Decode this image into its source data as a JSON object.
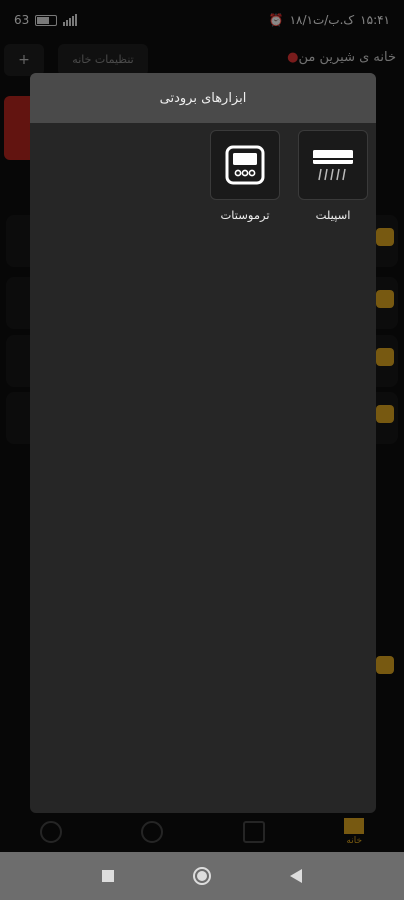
{
  "status_bar": {
    "time": "۱۵:۴۱",
    "date": "۱۸/۱ک.ب/ت",
    "battery": "63"
  },
  "background": {
    "add_label": "+",
    "home_settings": "تنظیمات خانه",
    "home_name": "خانه ی شیرین من",
    "bottom_nav_home": "خانه"
  },
  "modal": {
    "title": "ابزارهای برودتی",
    "devices": [
      {
        "label": "اسپیلت",
        "icon": "split-ac-icon"
      },
      {
        "label": "ترموستات",
        "icon": "thermostat-icon"
      }
    ]
  },
  "colors": {
    "accent": "#d9a21f",
    "modal_bg": "#262626",
    "modal_header": "#4a4a4a",
    "nav_bar": "#6d6d6d"
  }
}
